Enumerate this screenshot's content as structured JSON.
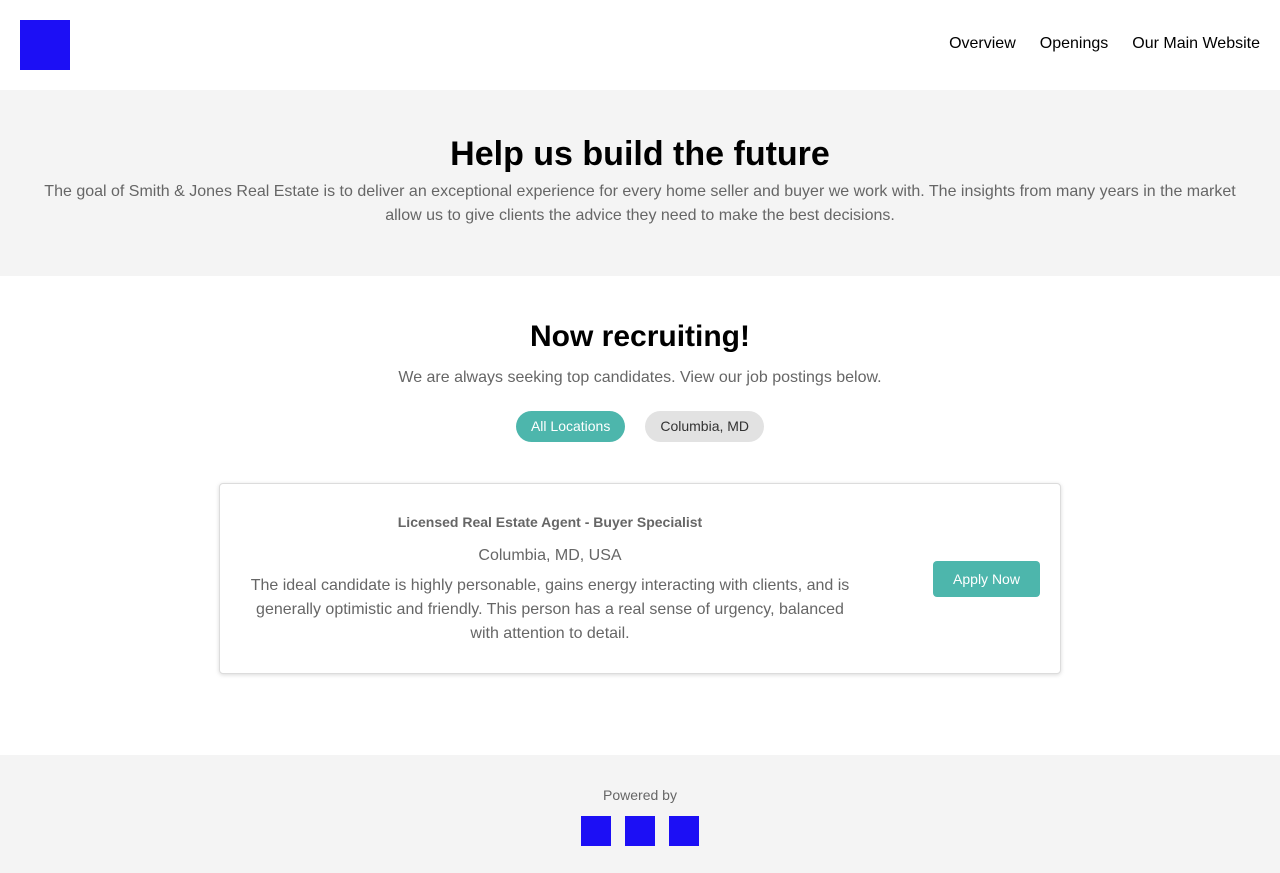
{
  "brand": {
    "logo_color": "#1c0ff5"
  },
  "nav": {
    "items": [
      "Overview",
      "Openings",
      "Our Main Website"
    ]
  },
  "hero": {
    "title": "Help us build the future",
    "description": "The goal of Smith & Jones Real Estate is to deliver an exceptional experience for every home seller and buyer we work with. The insights from many years in the market allow us to give clients the advice they need to make the best decisions."
  },
  "recruiting": {
    "title": "Now recruiting!",
    "subtitle": "We are always seeking top candidates. View our job postings below.",
    "filters": [
      {
        "label": "All Locations",
        "active": true
      },
      {
        "label": "Columbia, MD",
        "active": false
      }
    ]
  },
  "jobs": [
    {
      "title": "Licensed Real Estate Agent - Buyer Specialist",
      "location": "Columbia, MD, USA",
      "description": "The ideal candidate is highly personable, gains energy interacting with clients, and is generally optimistic and friendly. This person has a real sense of urgency, balanced with attention to detail.",
      "apply_label": "Apply Now"
    }
  ],
  "footer": {
    "powered_by": "Powered by",
    "logo_color": "#1c0ff5"
  },
  "colors": {
    "accent": "#4db6ac",
    "pill_inactive": "#e2e2e2",
    "band_bg": "#f4f4f4"
  }
}
